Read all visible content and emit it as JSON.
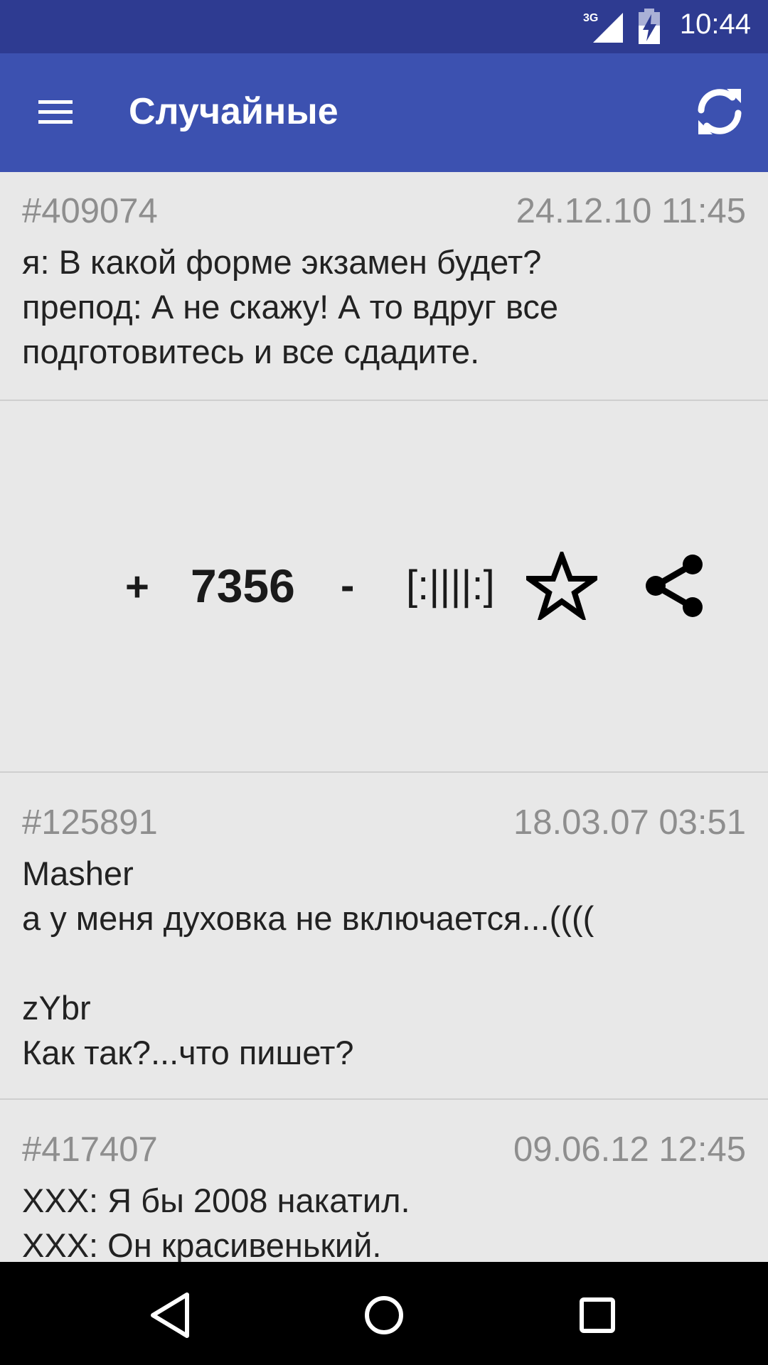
{
  "status_bar": {
    "network": "3G",
    "time": "10:44"
  },
  "app_bar": {
    "title": "Случайные"
  },
  "quotes": [
    {
      "number": "#409074",
      "date": "24.12.10 11:45",
      "text": "я: В какой форме экзамен будет?\nпрепод: А не скажу! А то вдруг все подготовитесь и все сдадите."
    },
    {
      "number": "#125891",
      "date": "18.03.07 03:51",
      "text": "Masher\nа у меня духовка не включается...((((\n\nzYbr\nКак так?...что пишет?"
    },
    {
      "number": "#417407",
      "date": "09.06.12 12:45",
      "text": "XXX: Я бы 2008 накатил.\nXXX: Он красивенький."
    }
  ],
  "actions": {
    "plus_label": "+",
    "rating": "7356",
    "minus_label": "-",
    "bayan_label": "[:||||:]"
  },
  "icons": {
    "menu": "menu-icon",
    "refresh": "refresh-icon",
    "star": "star-outline-icon",
    "share": "share-icon",
    "back": "back-icon",
    "home": "home-icon",
    "recents": "recents-icon"
  },
  "colors": {
    "status_bar": "#2e3b91",
    "app_bar": "#3c51b0",
    "background": "#e8e8e8",
    "meta_text": "#8e8e8e",
    "body_text": "#222222"
  }
}
